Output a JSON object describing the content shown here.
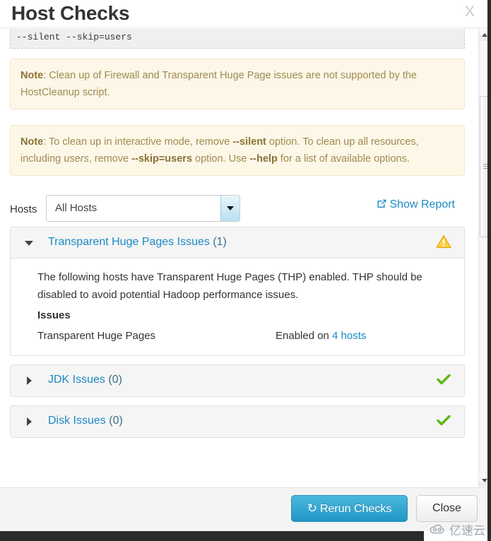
{
  "header": {
    "title": "Host Checks",
    "close_label": "X"
  },
  "code_block": {
    "text": "--silent --skip=users"
  },
  "notes": [
    {
      "label": "Note",
      "text": ": Clean up of Firewall and Transparent Huge Page issues are not supported by the HostCleanup script."
    },
    {
      "label": "Note",
      "parts": [
        ": To clean up in interactive mode, remove ",
        "--silent",
        " option. To clean up all resources, including ",
        "users",
        ", remove ",
        "--skip=users",
        " option. Use ",
        "--help",
        " for a list of available options."
      ]
    }
  ],
  "hosts_filter": {
    "label": "Hosts",
    "selected": "All Hosts",
    "options": [
      "All Hosts"
    ]
  },
  "show_report": {
    "label": "Show Report",
    "icon": "external-link-icon"
  },
  "panels": [
    {
      "title": "Transparent Huge Pages Issues",
      "count": "(1)",
      "expanded": true,
      "status_icon": "warning-triangle-icon",
      "status_color": "#f7c544",
      "description": "The following hosts have Transparent Huge Pages (THP) enabled. THP should be disabled to avoid potential Hadoop performance issues.",
      "issues_heading": "Issues",
      "issues": [
        {
          "name": "Transparent Huge Pages",
          "value_prefix": "Enabled on ",
          "value_link": "4 hosts"
        }
      ]
    },
    {
      "title": "JDK Issues",
      "count": "(0)",
      "expanded": false,
      "status_icon": "check-icon",
      "status_color": "#5cb811"
    },
    {
      "title": "Disk Issues",
      "count": "(0)",
      "expanded": false,
      "status_icon": "check-icon",
      "status_color": "#5cb811"
    }
  ],
  "footer": {
    "rerun_label": "Rerun Checks",
    "rerun_icon": "refresh-icon",
    "close_label": "Close"
  },
  "scrollbar": {
    "up_icon": "scroll-up-arrow-icon",
    "down_icon": "scroll-down-arrow-icon"
  },
  "watermark": {
    "text": "亿速云",
    "icon": "cloud-logo-icon"
  }
}
